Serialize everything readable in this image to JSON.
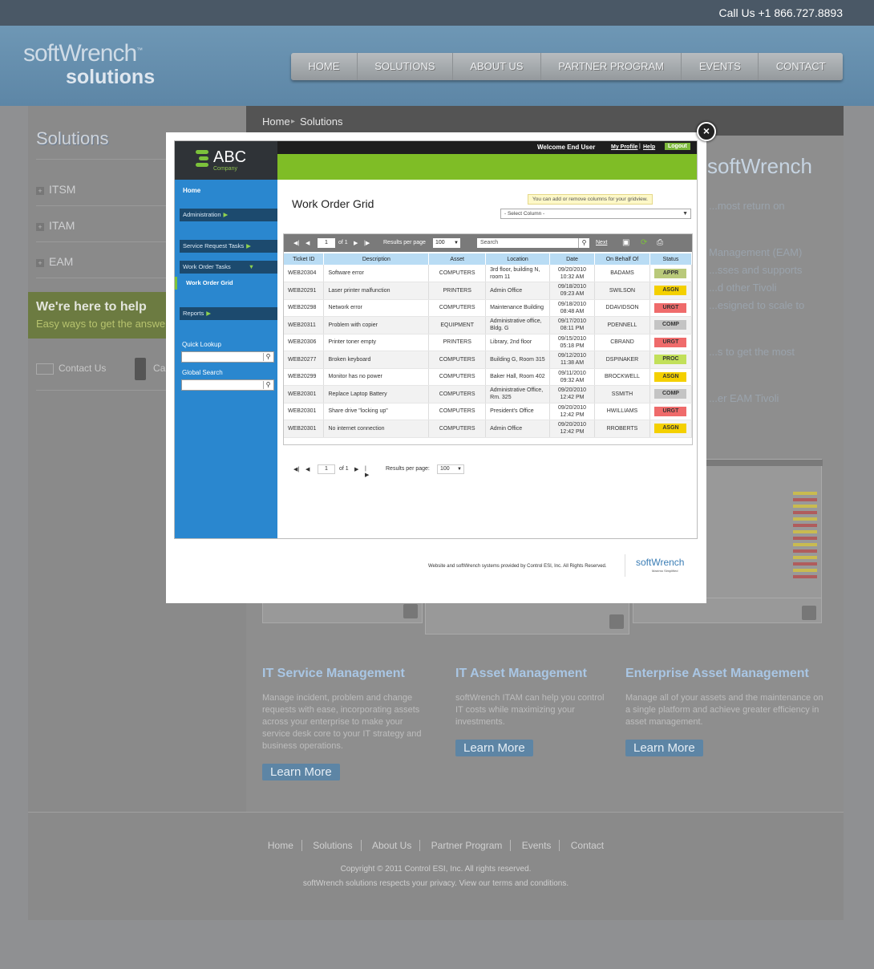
{
  "site": {
    "phone": "Call Us +1 866.727.8893",
    "logo_line1": "softWrench",
    "logo_tm": "™",
    "logo_line2": "solutions",
    "nav": [
      "HOME",
      "SOLUTIONS",
      "ABOUT US",
      "PARTNER PROGRAM",
      "EVENTS",
      "CONTACT"
    ],
    "left_title": "Solutions",
    "left_items": [
      "ITSM",
      "ITAM",
      "EAM"
    ],
    "help_title": "We're here to help",
    "help_sub": "Easy ways to get the answers",
    "contact_us": "Contact Us",
    "call_partial": "Call",
    "breadcrumb_home": "Home",
    "breadcrumb_sep": "▸",
    "breadcrumb_current": "Solutions",
    "right_logo": "softWrench",
    "ghost_lines": [
      "...most return on",
      "Management (EAM)",
      "...sses and supports",
      "...d other Tivoli",
      "...esigned to scale to",
      "...s to get the most",
      "...er EAM Tivoli"
    ],
    "columns": [
      {
        "title": "IT Service Management",
        "text": "Manage incident, problem and change requests with ease, incorporating assets across your enterprise to make your service desk core to your IT strategy and business operations.",
        "button": "Learn More"
      },
      {
        "title": "IT Asset Management",
        "text": "softWrench ITAM can help you control IT costs while maximizing your investments.",
        "button": "Learn More"
      },
      {
        "title": "Enterprise Asset Management",
        "text": "Manage all of your assets and the maintenance on a single platform and achieve greater efficiency in asset management.",
        "button": "Learn More"
      }
    ],
    "footer_links": [
      "Home",
      "Solutions",
      "About Us",
      "Partner Program",
      "Events",
      "Contact"
    ],
    "copyright": "Copyright © 2011 Control ESI, Inc. All rights reserved.",
    "footer_note": "softWrench solutions respects your privacy. View our terms and conditions."
  },
  "modal": {
    "close_label": "×",
    "brand": "ABC",
    "brand_sub": "Company",
    "welcome": "Welcome End User",
    "my_profile": "My Profile",
    "link_sep": "|",
    "help": "Help",
    "logout": "Logout",
    "sidebar": {
      "home": "Home",
      "administration": "Administration",
      "service_request_tasks": "Service Request Tasks",
      "work_order_tasks": "Work Order Tasks",
      "work_order_grid": "Work Order Grid",
      "reports": "Reports",
      "quick_lookup": "Quick Lookup",
      "global_search": "Global Search",
      "arrow_right": "▶",
      "arrow_down": "▼"
    },
    "page_title": "Work Order Grid",
    "tooltip": "You can add or remove columns for your gridview.",
    "select_column": "- Select Column -",
    "toolbar": {
      "page": "1",
      "of": "of 1",
      "results_label": "Results per page",
      "results_value": "100",
      "search_placeholder": "Search",
      "next": "Next"
    },
    "columns": [
      "Ticket ID",
      "Description",
      "Asset",
      "Location",
      "Date",
      "On Behalf Of",
      "Status"
    ],
    "rows": [
      {
        "id": "WEB20304",
        "desc": "Software error",
        "asset": "COMPUTERS",
        "loc": "3rd floor, building N, room 11",
        "date": "09/20/2010",
        "time": "10:32 AM",
        "who": "BADAMS",
        "status": "APPR",
        "color": "#b9c97a"
      },
      {
        "id": "WEB20291",
        "desc": "Laser printer malfunction",
        "asset": "PRINTERS",
        "loc": "Admin Office",
        "date": "09/18/2010",
        "time": "09:23 AM",
        "who": "SWILSON",
        "status": "ASGN",
        "color": "#f4d000"
      },
      {
        "id": "WEB20298",
        "desc": "Network error",
        "asset": "COMPUTERS",
        "loc": "Maintenance Building",
        "date": "09/18/2010",
        "time": "08:48 AM",
        "who": "DDAVIDSON",
        "status": "URGT",
        "color": "#ef6b6b"
      },
      {
        "id": "WEB20311",
        "desc": "Problem with copier",
        "asset": "EQUIPMENT",
        "loc": "Administrative office, Bldg. G",
        "date": "09/17/2010",
        "time": "08:11 PM",
        "who": "PDENNELL",
        "status": "COMP",
        "color": "#c4c4c4"
      },
      {
        "id": "WEB20306",
        "desc": "Printer toner empty",
        "asset": "PRINTERS",
        "loc": "Library, 2nd floor",
        "date": "09/15/2010",
        "time": "05:18 PM",
        "who": "CBRAND",
        "status": "URGT",
        "color": "#ef6b6b"
      },
      {
        "id": "WEB20277",
        "desc": "Broken keyboard",
        "asset": "COMPUTERS",
        "loc": "Building G, Room 315",
        "date": "09/12/2010",
        "time": "11:38 AM",
        "who": "DSPINAKER",
        "status": "PROC",
        "color": "#c2e05a"
      },
      {
        "id": "WEB20299",
        "desc": "Monitor has no power",
        "asset": "COMPUTERS",
        "loc": "Baker Hall, Room 402",
        "date": "09/11/2010",
        "time": "09:32 AM",
        "who": "BROCKWELL",
        "status": "ASGN",
        "color": "#f4d000"
      },
      {
        "id": "WEB20301",
        "desc": "Replace Laptop Battery",
        "asset": "COMPUTERS",
        "loc": "Administrative Office, Rm. 325",
        "date": "09/20/2010",
        "time": "12:42 PM",
        "who": "SSMITH",
        "status": "COMP",
        "color": "#c4c4c4"
      },
      {
        "id": "WEB20301",
        "desc": "Share drive \"locking up\"",
        "asset": "COMPUTERS",
        "loc": "President's Office",
        "date": "09/20/2010",
        "time": "12:42 PM",
        "who": "HWILLIAMS",
        "status": "URGT",
        "color": "#ef6b6b"
      },
      {
        "id": "WEB20301",
        "desc": "No internet connection",
        "asset": "COMPUTERS",
        "loc": "Admin Office",
        "date": "09/20/2010",
        "time": "12:42 PM",
        "who": "RROBERTS",
        "status": "ASGN",
        "color": "#f4d000"
      }
    ],
    "bottom_pager": {
      "page": "1",
      "of": "of 1",
      "results_label": "Results per page:",
      "results_value": "100"
    },
    "footer_text": "Website and softWrench systems provided by Control ESI, Inc. All Rights Reserved.",
    "footer_logo": "softWrench",
    "footer_logo_sub": "Maximo Simplified"
  }
}
